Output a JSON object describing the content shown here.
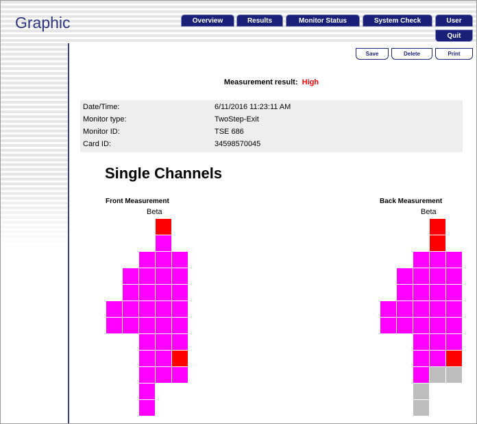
{
  "app": {
    "title": "Graphic"
  },
  "nav": {
    "tabs": [
      {
        "label": "Overview"
      },
      {
        "label": "Results"
      },
      {
        "label": "Monitor Status"
      },
      {
        "label": "System Check"
      },
      {
        "label": "User"
      }
    ],
    "quit_label": "Quit"
  },
  "actions": {
    "save_label": "Save",
    "delete_label": "Delete",
    "print_label": "Print"
  },
  "result": {
    "label": "Measurement result:",
    "value": "High",
    "value_color": "#ff0000"
  },
  "info": [
    {
      "label": "Date/Time:",
      "value": "6/11/2016 11:23:11 AM"
    },
    {
      "label": "Monitor type:",
      "value": "TwoStep-Exit"
    },
    {
      "label": "Monitor ID:",
      "value": "TSE 686"
    },
    {
      "label": "Card ID:",
      "value": "34598570045"
    }
  ],
  "section_title": "Single Channels",
  "colors": {
    "normal": "#ff00ff",
    "alarm": "#ff0000",
    "inactive": "#bdbdbd"
  },
  "front": {
    "title": "Front Measurement",
    "beta_label": "Beta",
    "cells": [
      [
        0,
        3,
        "alarm"
      ],
      [
        1,
        3,
        "normal"
      ],
      [
        2,
        2,
        "normal"
      ],
      [
        2,
        3,
        "normal"
      ],
      [
        2,
        4,
        "normal"
      ],
      [
        3,
        1,
        "normal"
      ],
      [
        3,
        2,
        "normal"
      ],
      [
        3,
        3,
        "normal"
      ],
      [
        3,
        4,
        "normal"
      ],
      [
        4,
        1,
        "normal"
      ],
      [
        4,
        2,
        "normal"
      ],
      [
        4,
        3,
        "normal"
      ],
      [
        4,
        4,
        "normal"
      ],
      [
        5,
        0,
        "normal"
      ],
      [
        5,
        1,
        "normal"
      ],
      [
        5,
        2,
        "normal"
      ],
      [
        5,
        3,
        "normal"
      ],
      [
        5,
        4,
        "normal"
      ],
      [
        6,
        0,
        "normal"
      ],
      [
        6,
        1,
        "normal"
      ],
      [
        6,
        2,
        "normal"
      ],
      [
        6,
        3,
        "normal"
      ],
      [
        6,
        4,
        "normal"
      ],
      [
        7,
        2,
        "normal"
      ],
      [
        7,
        3,
        "normal"
      ],
      [
        7,
        4,
        "normal"
      ],
      [
        8,
        2,
        "normal"
      ],
      [
        8,
        3,
        "normal"
      ],
      [
        8,
        4,
        "alarm"
      ],
      [
        9,
        2,
        "normal"
      ],
      [
        9,
        3,
        "normal"
      ],
      [
        9,
        4,
        "normal"
      ],
      [
        10,
        2,
        "normal"
      ],
      [
        11,
        2,
        "normal"
      ]
    ]
  },
  "back": {
    "title": "Back Measurement",
    "beta_label": "Beta",
    "cells": [
      [
        0,
        3,
        "alarm"
      ],
      [
        1,
        3,
        "alarm"
      ],
      [
        2,
        2,
        "normal"
      ],
      [
        2,
        3,
        "normal"
      ],
      [
        2,
        4,
        "normal"
      ],
      [
        3,
        1,
        "normal"
      ],
      [
        3,
        2,
        "normal"
      ],
      [
        3,
        3,
        "normal"
      ],
      [
        3,
        4,
        "normal"
      ],
      [
        4,
        1,
        "normal"
      ],
      [
        4,
        2,
        "normal"
      ],
      [
        4,
        3,
        "normal"
      ],
      [
        4,
        4,
        "normal"
      ],
      [
        5,
        0,
        "normal"
      ],
      [
        5,
        1,
        "normal"
      ],
      [
        5,
        2,
        "normal"
      ],
      [
        5,
        3,
        "normal"
      ],
      [
        5,
        4,
        "normal"
      ],
      [
        6,
        0,
        "normal"
      ],
      [
        6,
        1,
        "normal"
      ],
      [
        6,
        2,
        "normal"
      ],
      [
        6,
        3,
        "normal"
      ],
      [
        6,
        4,
        "normal"
      ],
      [
        7,
        2,
        "normal"
      ],
      [
        7,
        3,
        "normal"
      ],
      [
        7,
        4,
        "normal"
      ],
      [
        8,
        2,
        "normal"
      ],
      [
        8,
        3,
        "normal"
      ],
      [
        8,
        4,
        "alarm"
      ],
      [
        9,
        2,
        "normal"
      ],
      [
        9,
        3,
        "inactive"
      ],
      [
        9,
        4,
        "inactive"
      ],
      [
        10,
        2,
        "inactive"
      ],
      [
        11,
        2,
        "inactive"
      ]
    ]
  }
}
